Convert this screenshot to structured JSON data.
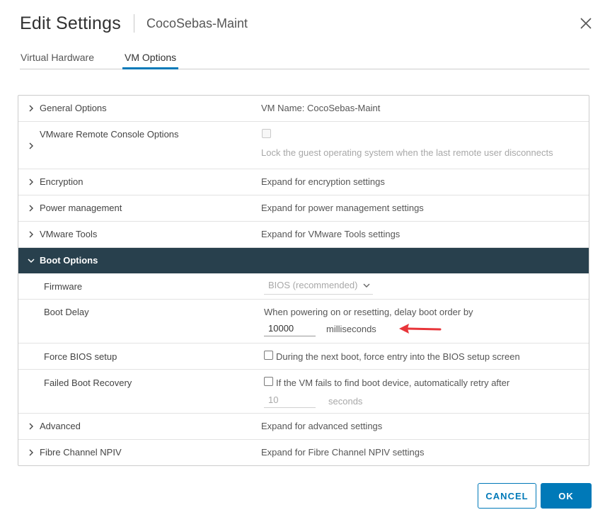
{
  "dialog": {
    "title": "Edit Settings",
    "subtitle": "CocoSebas-Maint"
  },
  "tabs": [
    {
      "label": "Virtual Hardware",
      "active": false
    },
    {
      "label": "VM Options",
      "active": true
    }
  ],
  "sections": {
    "general": {
      "label": "General Options",
      "value": "VM Name: CocoSebas-Maint"
    },
    "remote_console": {
      "label": "VMware Remote Console Options",
      "checkbox_text": "Lock the guest operating system when the last remote user disconnects",
      "checked": false
    },
    "encryption": {
      "label": "Encryption",
      "value": "Expand for encryption settings"
    },
    "power": {
      "label": "Power management",
      "value": "Expand for power management settings"
    },
    "tools": {
      "label": "VMware Tools",
      "value": "Expand for VMware Tools settings"
    },
    "boot": {
      "label": "Boot Options",
      "firmware": {
        "label": "Firmware",
        "selected": "BIOS (recommended)"
      },
      "boot_delay": {
        "label": "Boot Delay",
        "description": "When powering on or resetting, delay boot order by",
        "value": "10000",
        "unit": "milliseconds"
      },
      "force_bios": {
        "label": "Force BIOS setup",
        "checkbox_text": "During the next boot, force entry into the BIOS setup screen",
        "checked": false
      },
      "failed_recovery": {
        "label": "Failed Boot Recovery",
        "checkbox_text": "If the VM fails to find boot device, automatically retry after",
        "checked": false,
        "value": "10",
        "unit": "seconds"
      }
    },
    "advanced": {
      "label": "Advanced",
      "value": "Expand for advanced settings"
    },
    "fibre": {
      "label": "Fibre Channel NPIV",
      "value": "Expand for Fibre Channel NPIV settings"
    }
  },
  "buttons": {
    "cancel": "CANCEL",
    "ok": "OK"
  },
  "colors": {
    "accent": "#0079b8",
    "section_header_bg": "#28404d",
    "annotation_arrow": "#e8353a"
  },
  "icons": {
    "close": "close-icon",
    "collapsed": "chevron-right-icon",
    "expanded": "chevron-down-icon",
    "dropdown": "chevron-down-icon",
    "annotation": "red-arrow-icon"
  }
}
